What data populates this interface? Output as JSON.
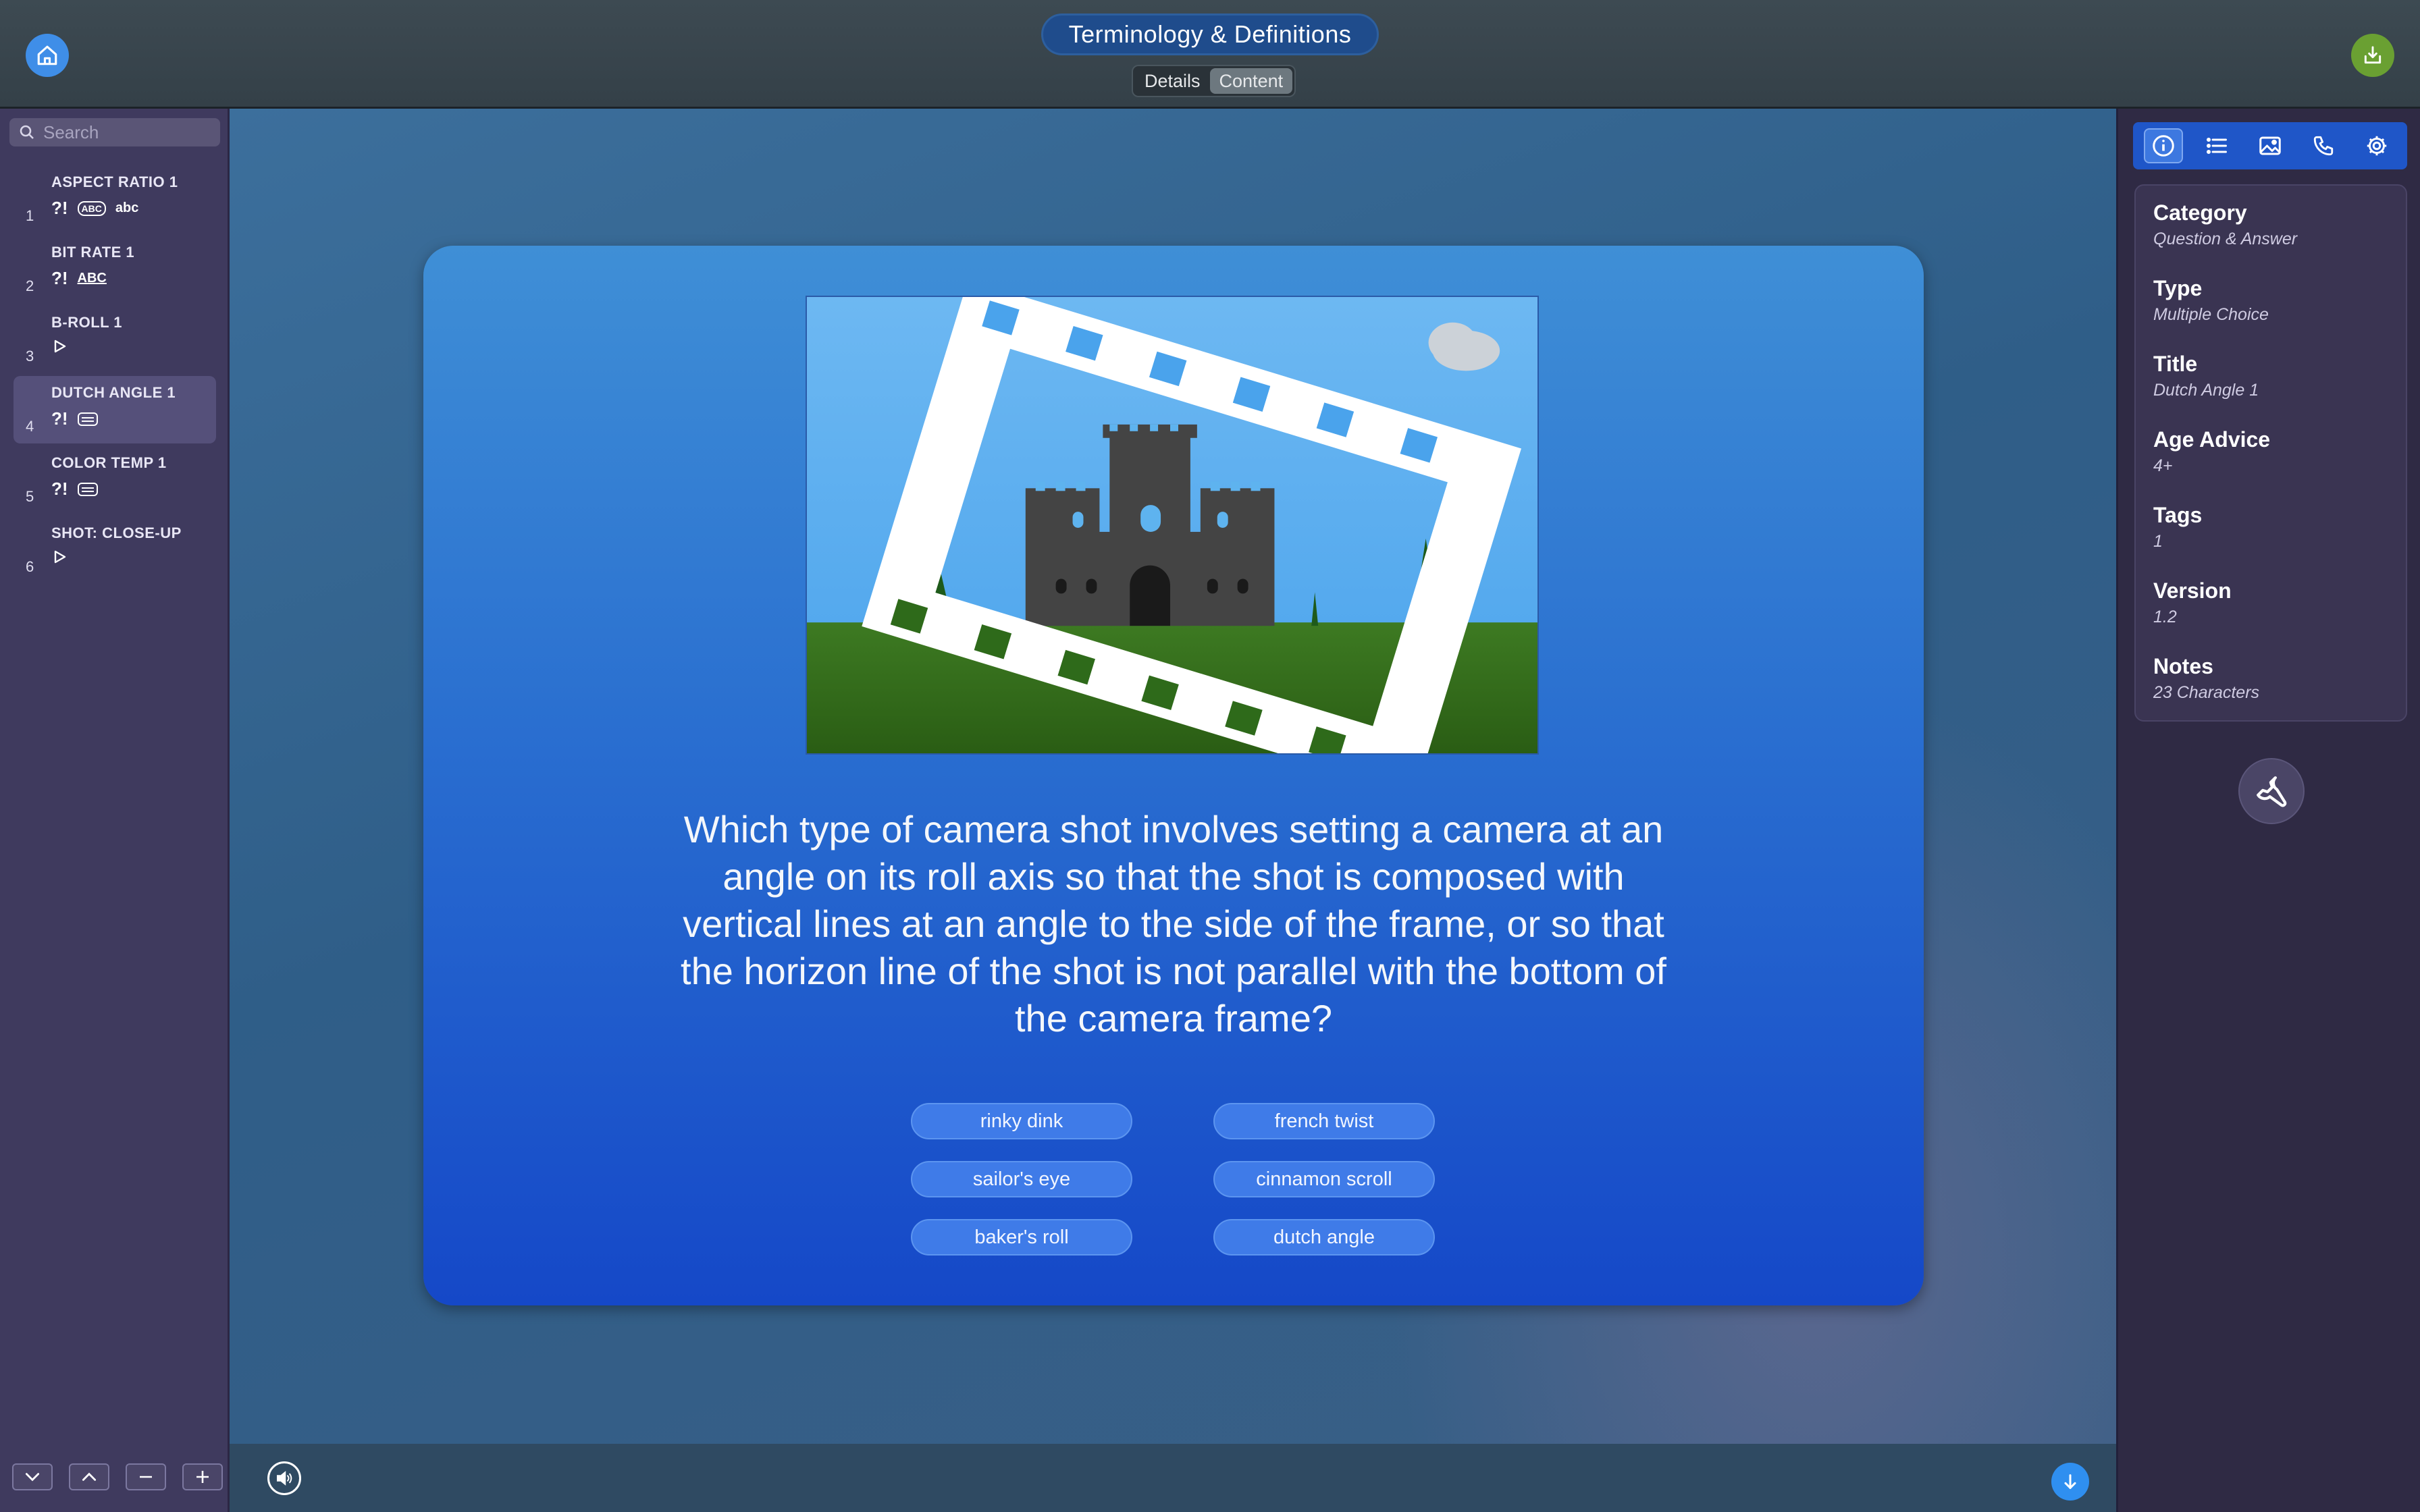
{
  "header": {
    "title": "Terminology & Definitions",
    "segments": [
      "Details",
      "Content"
    ],
    "active_segment": "Content"
  },
  "sidebar": {
    "search_placeholder": "Search",
    "slides": [
      {
        "num": "1",
        "name": "ASPECT RATIO 1",
        "icons": [
          "question-mark-icon",
          "abc-box-icon",
          "abc-icon"
        ],
        "abc_label": "abc",
        "box_label": "ABC"
      },
      {
        "num": "2",
        "name": "BIT RATE 1",
        "icons": [
          "question-mark-icon",
          "abc-underline-icon"
        ],
        "abc_label": "ABC"
      },
      {
        "num": "3",
        "name": "B-ROLL 1",
        "icons": [
          "play-icon"
        ]
      },
      {
        "num": "4",
        "name": "DUTCH ANGLE 1",
        "icons": [
          "question-mark-icon",
          "list-icon"
        ],
        "selected": true
      },
      {
        "num": "5",
        "name": "COLOR TEMP 1",
        "icons": [
          "question-mark-icon",
          "list-icon"
        ]
      },
      {
        "num": "6",
        "name": "SHOT: CLOSE-UP",
        "icons": [
          "play-icon"
        ]
      }
    ],
    "question_glyph": "?!"
  },
  "card": {
    "question": "Which type of camera shot involves setting a camera at an angle on its roll axis so that the shot is composed with vertical lines at an angle to the side of the frame, or so that the horizon line of the shot is not parallel with the bottom of the camera frame?",
    "answers": [
      "rinky dink",
      "french twist",
      "sailor's eye",
      "cinnamon scroll",
      "baker's roll",
      "dutch angle"
    ]
  },
  "inspector": {
    "tabs": [
      "info-icon",
      "list-icon",
      "image-icon",
      "phone-icon",
      "gear-icon"
    ],
    "properties": [
      {
        "label": "Category",
        "value": "Question & Answer"
      },
      {
        "label": "Type",
        "value": "Multiple Choice"
      },
      {
        "label": "Title",
        "value": "Dutch Angle 1"
      },
      {
        "label": "Age Advice",
        "value": "4+"
      },
      {
        "label": "Tags",
        "value": "1"
      },
      {
        "label": "Version",
        "value": "1.2"
      },
      {
        "label": "Notes",
        "value": "23 Characters"
      }
    ]
  },
  "colors": {
    "accent": "#3f8ee8",
    "sidebar": "#3f3a5e",
    "card_top": "#3f8fd6",
    "card_bottom": "#1548c8",
    "export_green": "#6aa032"
  }
}
